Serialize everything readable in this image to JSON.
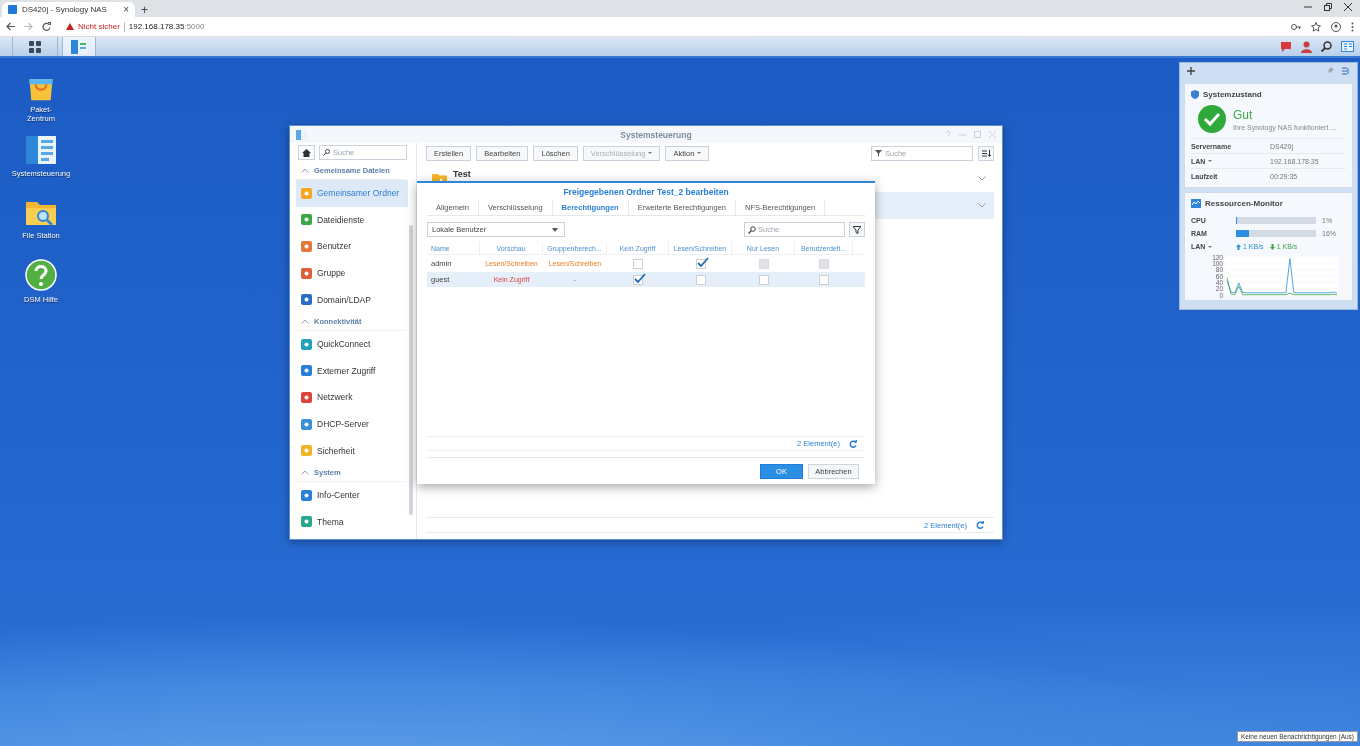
{
  "browser": {
    "tab": {
      "title": "DS420j - Synology NAS",
      "close": "×"
    },
    "new_tab": "+",
    "address": {
      "warning": "Nicht sicher",
      "host": "192.168.178.35",
      "port": ":5000"
    }
  },
  "taskbar": {
    "apps": [
      {
        "kind": "menu",
        "selected": false
      },
      {
        "kind": "control-panel",
        "selected": true
      }
    ]
  },
  "desktop_icons": [
    {
      "kind": "package",
      "label": "Paket-Zentrum"
    },
    {
      "kind": "control-panel",
      "label": "Systemsteuerung"
    },
    {
      "kind": "folder",
      "label": "File Station"
    },
    {
      "kind": "help",
      "label": "DSM Hilfe"
    }
  ],
  "control_panel": {
    "title": "Systemsteuerung",
    "search": {
      "placeholder": "Suche"
    },
    "sidebar": [
      {
        "section": "Gemeinsame Dateien",
        "items": [
          {
            "label": "Gemeinsamer Ordner",
            "color": "#f5a623",
            "selected": true
          },
          {
            "label": "Dateidienste",
            "color": "#3aa845",
            "selected": false
          },
          {
            "label": "Benutzer",
            "color": "#e07a3a",
            "selected": false
          },
          {
            "label": "Gruppe",
            "color": "#d9603b",
            "selected": false
          },
          {
            "label": "Domain/LDAP",
            "color": "#2a6fc4",
            "selected": false
          }
        ]
      },
      {
        "section": "Konnektivität",
        "items": [
          {
            "label": "QuickConnect",
            "color": "#24a0b8",
            "selected": false
          },
          {
            "label": "Externer Zugriff",
            "color": "#2a7fd4",
            "selected": false
          },
          {
            "label": "Netzwerk",
            "color": "#d9453b",
            "selected": false
          },
          {
            "label": "DHCP-Server",
            "color": "#3b8fd9",
            "selected": false
          },
          {
            "label": "Sicherheit",
            "color": "#f0b429",
            "selected": false
          }
        ]
      },
      {
        "section": "System",
        "items": [
          {
            "label": "Info-Center",
            "color": "#2a80d6",
            "selected": false
          },
          {
            "label": "Thema",
            "color": "#27a88a",
            "selected": false
          }
        ]
      }
    ],
    "toolbar": [
      {
        "label": "Erstellen",
        "disabled": false,
        "dropdown": false
      },
      {
        "label": "Bearbeiten",
        "disabled": false,
        "dropdown": false
      },
      {
        "label": "Löschen",
        "disabled": false,
        "dropdown": false
      },
      {
        "label": "Verschlüsselung",
        "disabled": true,
        "dropdown": true
      },
      {
        "label": "Aktion",
        "disabled": false,
        "dropdown": true
      }
    ],
    "filter": {
      "placeholder": "Suche"
    },
    "folders": [
      {
        "name": "Test",
        "selected": false
      },
      {
        "selected": true
      }
    ],
    "footer": "2 Element(e)"
  },
  "dialog": {
    "title": "Freigegebenen Ordner Test_2 bearbeiten",
    "tabs": [
      {
        "label": "Allgemein",
        "selected": false
      },
      {
        "label": "Verschlüsselung",
        "selected": false
      },
      {
        "label": "Berechtigungen",
        "selected": true
      },
      {
        "label": "Erweiterte Berechtigungen",
        "selected": false
      },
      {
        "label": "NFS-Berechtigungen",
        "selected": false
      }
    ],
    "user_type": "Lokale Benutzer",
    "search": {
      "placeholder": "Suche"
    },
    "columns": [
      "Name",
      "Vorschau",
      "Gruppenberech...",
      "Kein Zugriff",
      "Lesen/Schreiben",
      "Nur Lesen",
      "Benutzerdefi..."
    ],
    "rows": [
      {
        "name": "admin",
        "preview": "Lesen/Schreiben",
        "group": "Lesen/Schreiben",
        "kind": "read_write",
        "selected": false,
        "permissions": [
          {
            "checked": false,
            "disabled": false
          },
          {
            "checked": true,
            "disabled": false
          },
          {
            "checked": false,
            "disabled": true
          },
          {
            "checked": false,
            "disabled": true
          }
        ]
      },
      {
        "name": "guest",
        "preview": "Kein Zugriff",
        "group": "-",
        "kind": "no_access",
        "selected": true,
        "permissions": [
          {
            "checked": true,
            "disabled": false
          },
          {
            "checked": false,
            "disabled": false
          },
          {
            "checked": false,
            "disabled": false
          },
          {
            "checked": false,
            "disabled": false
          }
        ]
      }
    ],
    "count": "2 Element(e)",
    "buttons": [
      {
        "label": "OK",
        "kind": "primary"
      },
      {
        "label": "Abbrechen",
        "kind": "secondary"
      }
    ]
  },
  "widgets": {
    "health": {
      "title": "Systemzustand",
      "status": "Gut",
      "message": "Ihre Synology NAS funktioniert ...",
      "fields": [
        {
          "label": "Servername",
          "value": "DS420j",
          "dropdown": false
        },
        {
          "label": "LAN",
          "value": "192.168.178.35",
          "dropdown": true
        },
        {
          "label": "Laufzeit",
          "value": "00:29:35",
          "dropdown": false
        }
      ]
    },
    "monitor": {
      "title": "Ressourcen-Monitor",
      "meters": [
        {
          "label": "CPU",
          "level": 0.01,
          "reading": "1%"
        },
        {
          "label": "RAM",
          "level": 0.16,
          "reading": "16%"
        }
      ],
      "lan": {
        "label": "LAN",
        "upload": "1 KB/s",
        "download": "1 KB/s"
      },
      "chart_data": {
        "type": "line",
        "grid": true,
        "ylim": [
          0,
          120
        ],
        "yticks": [
          0,
          20,
          40,
          60,
          80,
          100,
          120
        ],
        "series": [
          {
            "color": "#2a8fd6",
            "values": [
              45,
              10,
              7,
              38,
              8,
              7,
              7,
              7,
              7,
              7,
              7,
              7,
              7,
              7,
              7,
              7,
              115,
              8,
              7,
              7,
              7,
              7,
              7,
              7,
              7,
              7,
              7,
              9,
              7
            ]
          },
          {
            "color": "#3aa845",
            "values": [
              55,
              3,
              1,
              28,
              1,
              1,
              1,
              1,
              1,
              1,
              1,
              1,
              1,
              1,
              1,
              1,
              6,
              1,
              1,
              1,
              1,
              1,
              1,
              1,
              1,
              1,
              1,
              2,
              1
            ]
          }
        ]
      }
    }
  },
  "notification_tooltip": "Keine neuen Benachrichtigungen (Aus)"
}
